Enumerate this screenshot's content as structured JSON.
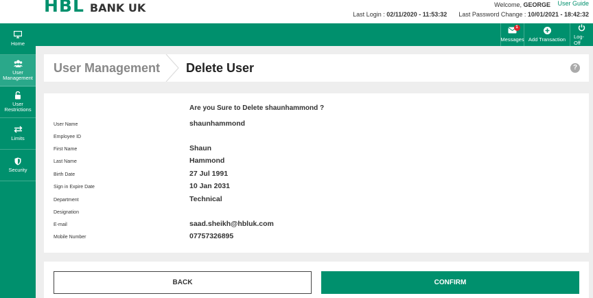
{
  "brand": {
    "logo_mark": "HBL",
    "name": "BANK UK",
    "color": "#00906d"
  },
  "header": {
    "welcome_prefix": "Welcome,",
    "username": "GEORGE",
    "user_guide": "User Guide",
    "last_login_label": "Last Login :",
    "last_login_value": "02/11/2020 - 11:53:32",
    "last_pwd_label": "Last Password Change :",
    "last_pwd_value": "10/01/2021 - 18:42:32"
  },
  "topbar": {
    "messages": {
      "label": "Messages",
      "badge": "1",
      "icon": "envelope-icon"
    },
    "add_transaction": {
      "label": "Add Transaction",
      "icon": "plus-circle-icon"
    },
    "logoff": {
      "label": "Log-Off",
      "icon": "power-icon"
    }
  },
  "sidebar": {
    "items": [
      {
        "label": "Home",
        "icon": "monitor-icon",
        "active": false
      },
      {
        "label": "User Management",
        "icon": "users-icon",
        "active": true
      },
      {
        "label": "User Restrictions",
        "icon": "lock-icon",
        "active": false
      },
      {
        "label": "Limits",
        "icon": "exchange-icon",
        "active": false
      },
      {
        "label": "Security",
        "icon": "shield-icon",
        "active": false
      }
    ]
  },
  "page": {
    "breadcrumb_parent": "User Management",
    "title": "Delete User",
    "help": "?"
  },
  "details": {
    "question": "Are you Sure to Delete shaunhammond ?",
    "fields": [
      {
        "label": "User Name",
        "value": "shaunhammond"
      },
      {
        "label": "Employee ID",
        "value": ""
      },
      {
        "label": "First Name",
        "value": "Shaun"
      },
      {
        "label": "Last Name",
        "value": "Hammond"
      },
      {
        "label": "Birth Date",
        "value": "27 Jul 1991"
      },
      {
        "label": "Sign in Expire Date",
        "value": "10 Jan 2031"
      },
      {
        "label": "Department",
        "value": "Technical"
      },
      {
        "label": "Designation",
        "value": ""
      },
      {
        "label": "E-mail",
        "value": "saad.sheikh@hbluk.com"
      },
      {
        "label": "Mobile Number",
        "value": "07757326895"
      }
    ]
  },
  "actions": {
    "back": "BACK",
    "confirm": "CONFIRM"
  }
}
